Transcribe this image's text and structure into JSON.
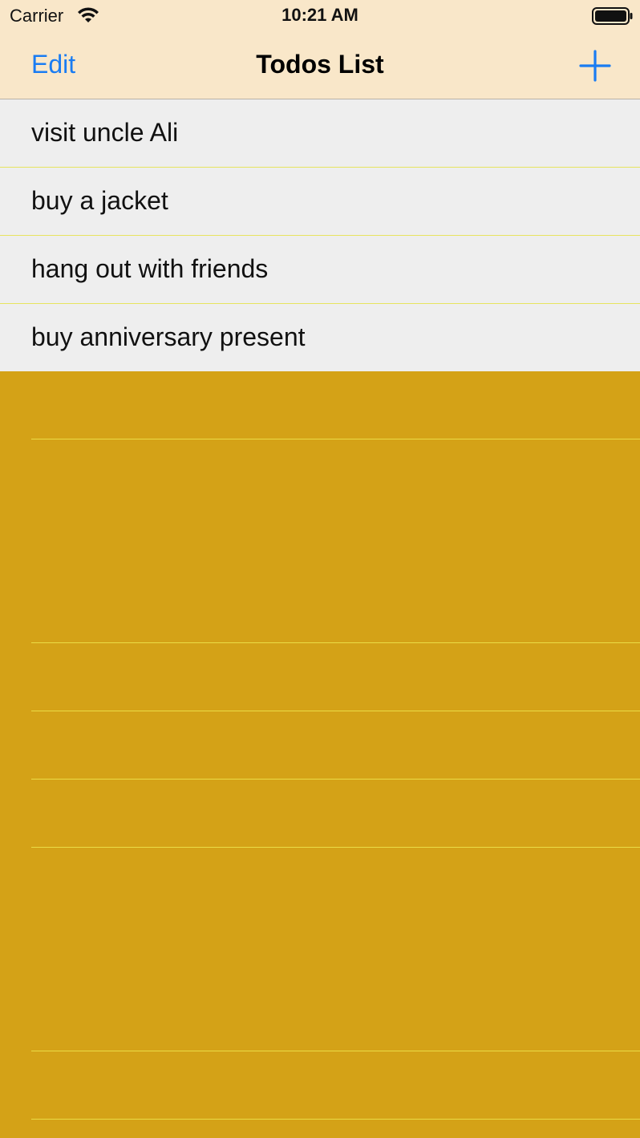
{
  "status_bar": {
    "carrier": "Carrier",
    "time": "10:21 AM",
    "wifi_icon": "wifi-icon",
    "battery_icon": "battery-full-icon"
  },
  "nav": {
    "edit_label": "Edit",
    "title": "Todos List",
    "add_icon": "plus-icon"
  },
  "todos": [
    {
      "text": "visit uncle Ali"
    },
    {
      "text": "buy a jacket"
    },
    {
      "text": "hang out with friends"
    },
    {
      "text": "buy anniversary present"
    }
  ],
  "colors": {
    "header_bg": "#F9E7C9",
    "accent": "#1A7CF2",
    "row_bg": "#EEEEEE",
    "empty_bg": "#D4A217",
    "separator": "#EADC46"
  }
}
